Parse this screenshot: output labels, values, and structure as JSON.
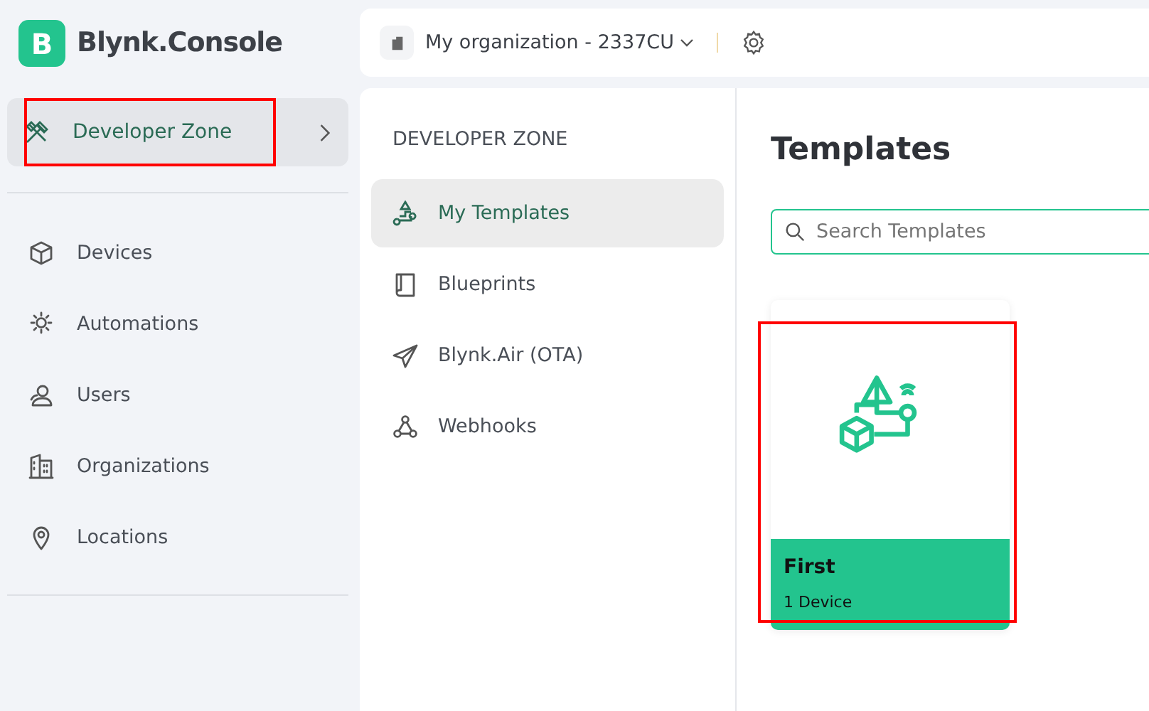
{
  "logo": {
    "letter": "B",
    "title": "Blynk.Console"
  },
  "sidebar": {
    "zone": {
      "label": "Developer Zone",
      "selected": true,
      "highlighted": true
    },
    "items": [
      {
        "label": "Devices",
        "kind": "cube"
      },
      {
        "label": "Automations",
        "kind": "sun"
      },
      {
        "label": "Users",
        "kind": "users"
      },
      {
        "label": "Organizations",
        "kind": "building"
      },
      {
        "label": "Locations",
        "kind": "pin"
      }
    ]
  },
  "topbar": {
    "organization": "My organization - 2337CU"
  },
  "subnav": {
    "heading": "DEVELOPER ZONE",
    "items": [
      {
        "label": "My Templates",
        "kind": "templates",
        "selected": true
      },
      {
        "label": "Blueprints",
        "kind": "book",
        "selected": false
      },
      {
        "label": "Blynk.Air (OTA)",
        "kind": "plane",
        "selected": false
      },
      {
        "label": "Webhooks",
        "kind": "webhook",
        "selected": false
      }
    ]
  },
  "content": {
    "title": "Templates",
    "search": {
      "placeholder": "Search Templates"
    },
    "templates": [
      {
        "name": "First",
        "devices": "1 Device",
        "highlighted": true
      }
    ]
  }
}
